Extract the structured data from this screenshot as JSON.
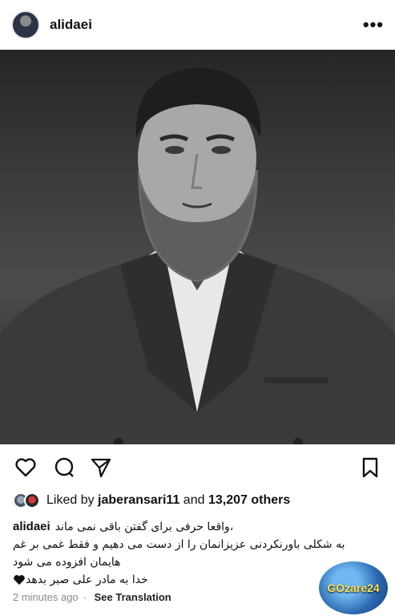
{
  "post": {
    "username": "alidaei",
    "liked_by": {
      "prefix": "Liked by",
      "user": "jaberansari11",
      "conjunction": "and",
      "others": "13,207 others"
    },
    "caption": {
      "author": "alidaei",
      "line1": "،واقعا حرفی برای گفتن باقی نمی ماند",
      "line2": "به شکلی باورنکردنی عزیزانمان را از دست می دهیم و فقط غمی بر غم",
      "line3": "هایمان افزوده می شود",
      "line4": "خدا به مادر علی صبر بدهد"
    },
    "time": "2 minutes ago",
    "translate": "See Translation",
    "watermark": "GOzare24"
  },
  "icons": [
    "more-icon",
    "heart-icon",
    "comment-icon",
    "share-icon",
    "bookmark-icon",
    "black-heart-icon"
  ]
}
